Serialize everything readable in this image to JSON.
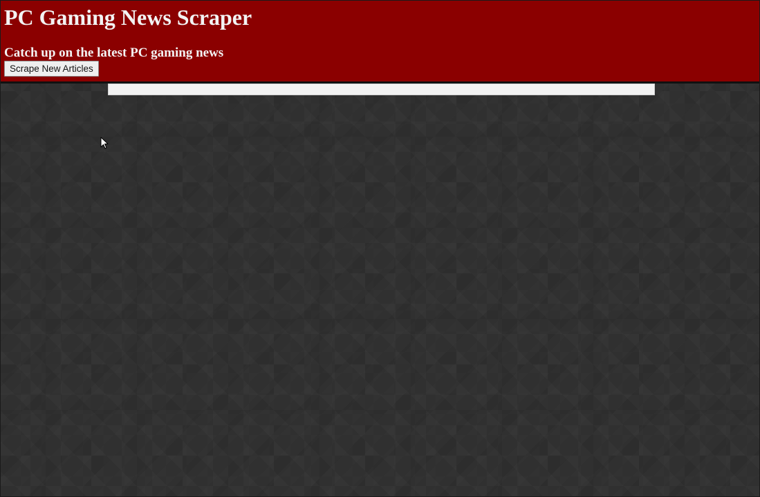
{
  "header": {
    "title": "PC Gaming News Scraper",
    "subtitle": "Catch up on the latest PC gaming news",
    "scrape_button_label": "Scrape New Articles"
  },
  "main": {
    "articles": []
  },
  "colors": {
    "header_background": "#8b0000",
    "page_background": "#303030",
    "articles_panel": "#f2f2f2"
  },
  "icons": {
    "cursor": "mouse-pointer-icon"
  }
}
